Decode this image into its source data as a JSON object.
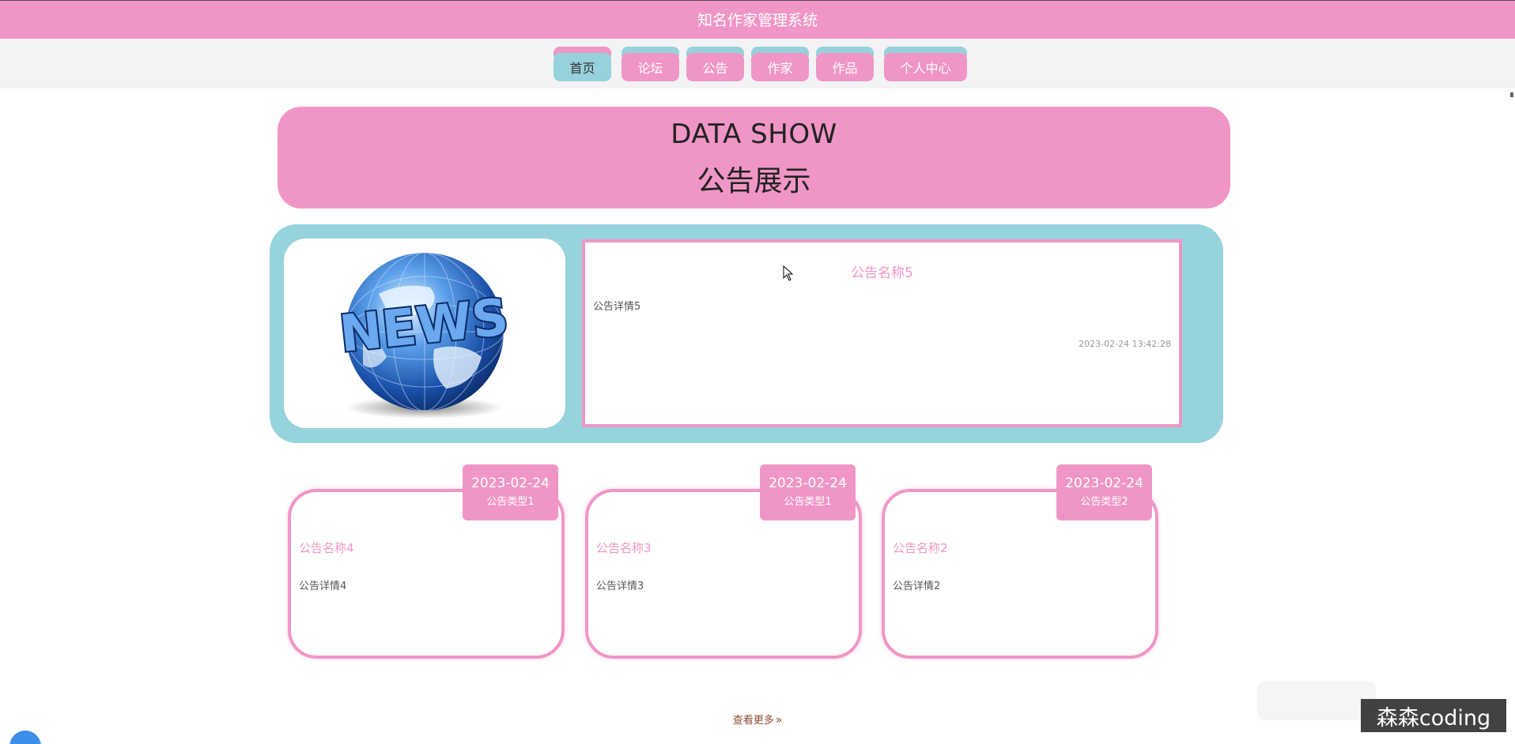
{
  "header": {
    "title": "知名作家管理系统"
  },
  "nav": {
    "items": [
      {
        "label": "首页",
        "active": true
      },
      {
        "label": "论坛",
        "active": false
      },
      {
        "label": "公告",
        "active": false
      },
      {
        "label": "作家",
        "active": false
      },
      {
        "label": "作品",
        "active": false
      },
      {
        "label": "个人中心",
        "active": false
      }
    ]
  },
  "banner": {
    "title_en": "DATA SHOW",
    "title_cn": "公告展示"
  },
  "featured": {
    "name": "公告名称5",
    "detail": "公告详情5",
    "date": "2023-02-24 13:42:28",
    "image_text": "NEWS"
  },
  "cards": [
    {
      "date": "2023-02-24",
      "type": "公告类型1",
      "name": "公告名称4",
      "detail": "公告详情4"
    },
    {
      "date": "2023-02-24",
      "type": "公告类型1",
      "name": "公告名称3",
      "detail": "公告详情3"
    },
    {
      "date": "2023-02-24",
      "type": "公告类型2",
      "name": "公告名称2",
      "detail": "公告详情2"
    }
  ],
  "more": {
    "label": "查看更多",
    "arrow": "»"
  },
  "watermark": {
    "text": "森森coding"
  },
  "colors": {
    "pink": "#f096c6",
    "teal": "#97d3dc"
  }
}
